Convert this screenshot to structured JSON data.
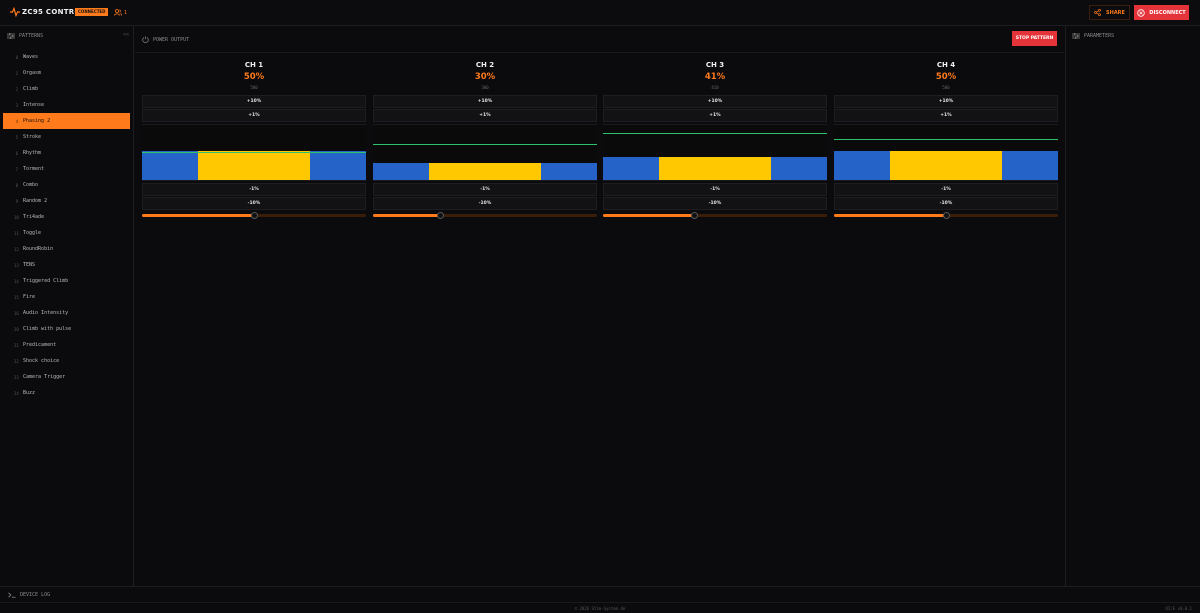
{
  "colors": {
    "accent": "#ff7a1a",
    "danger": "#e4343a",
    "wave_blue": "#2563c9",
    "wave_yellow": "#ffc800",
    "wave_line": "#2ec26a"
  },
  "header": {
    "title": "ZC95 CONTROL",
    "status_badge": "CONNECTED",
    "user_count": "1",
    "share_label": "SHARE",
    "disconnect_label": "DISCONNECT"
  },
  "sidebar": {
    "title": "PATTERNS",
    "collapse_label": "<<",
    "items": [
      {
        "num": "0",
        "label": "Waves",
        "active": false
      },
      {
        "num": "1",
        "label": "Orgasm",
        "active": false
      },
      {
        "num": "2",
        "label": "Climb",
        "active": false
      },
      {
        "num": "3",
        "label": "Intense",
        "active": false
      },
      {
        "num": "4",
        "label": "Phasing 2",
        "active": true
      },
      {
        "num": "5",
        "label": "Stroke",
        "active": false
      },
      {
        "num": "6",
        "label": "Rhythm",
        "active": false
      },
      {
        "num": "7",
        "label": "Torment",
        "active": false
      },
      {
        "num": "8",
        "label": "Combo",
        "active": false
      },
      {
        "num": "9",
        "label": "Random 2",
        "active": false
      },
      {
        "num": "10",
        "label": "Tri4ade",
        "active": false
      },
      {
        "num": "11",
        "label": "Toggle",
        "active": false
      },
      {
        "num": "12",
        "label": "RoundRobin",
        "active": false
      },
      {
        "num": "13",
        "label": "TENS",
        "active": false
      },
      {
        "num": "14",
        "label": "Triggered Climb",
        "active": false
      },
      {
        "num": "15",
        "label": "Fire",
        "active": false
      },
      {
        "num": "16",
        "label": "Audio Intensity",
        "active": false
      },
      {
        "num": "20",
        "label": "Climb with pulse",
        "active": false
      },
      {
        "num": "21",
        "label": "Predicament",
        "active": false
      },
      {
        "num": "22",
        "label": "Shock choice",
        "active": false
      },
      {
        "num": "23",
        "label": "Camera Trigger",
        "active": false
      },
      {
        "num": "24",
        "label": "Buzz",
        "active": false
      }
    ]
  },
  "main": {
    "title": "POWER OUTPUT",
    "stop_label": "STOP PATTERN",
    "channels": [
      {
        "name": "CH 1",
        "percent": "50%",
        "raw": "500",
        "plus10": "+10%",
        "plus1": "+1%",
        "minus1": "-1%",
        "minus10": "-10%",
        "power": 0.5,
        "wave": {
          "blue_level": 0.5,
          "yellow_level": 0.5,
          "line_level": 0.52
        }
      },
      {
        "name": "CH 2",
        "percent": "30%",
        "raw": "300",
        "plus10": "+10%",
        "plus1": "+1%",
        "minus1": "-1%",
        "minus10": "-10%",
        "power": 0.3,
        "wave": {
          "blue_level": 0.3,
          "yellow_level": 0.3,
          "line_level": 0.66
        }
      },
      {
        "name": "CH 3",
        "percent": "41%",
        "raw": "410",
        "plus10": "+10%",
        "plus1": "+1%",
        "minus1": "-1%",
        "minus10": "-10%",
        "power": 0.41,
        "wave": {
          "blue_level": 0.41,
          "yellow_level": 0.41,
          "line_level": 0.86
        }
      },
      {
        "name": "CH 4",
        "percent": "50%",
        "raw": "500",
        "plus10": "+10%",
        "plus1": "+1%",
        "minus1": "-1%",
        "minus10": "-10%",
        "power": 0.5,
        "wave": {
          "blue_level": 0.5,
          "yellow_level": 0.5,
          "line_level": 0.75
        }
      }
    ]
  },
  "right_panel": {
    "title": "PARAMETERS"
  },
  "footer": {
    "device_log_label": "DEVICE LOG",
    "copyright": "© 2026 Stim-System.de",
    "version": "UI/E v0.0.1"
  }
}
